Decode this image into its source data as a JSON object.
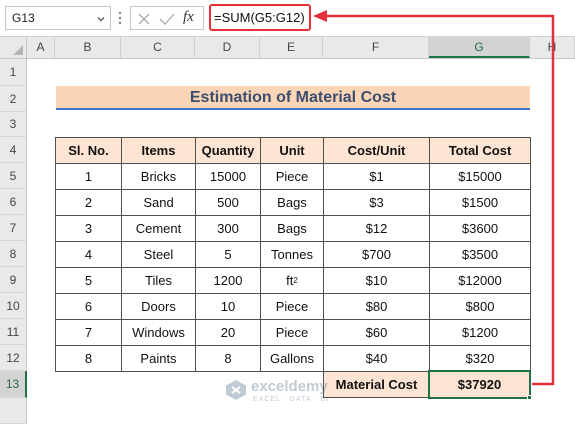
{
  "name_box": {
    "value": "G13"
  },
  "formula_bar": {
    "fx_label": "fx",
    "formula": "=SUM(G5:G12)"
  },
  "columns": [
    "A",
    "B",
    "C",
    "D",
    "E",
    "F",
    "G",
    "H"
  ],
  "selected_column": "G",
  "rows": [
    "1",
    "2",
    "3",
    "4",
    "5",
    "6",
    "7",
    "8",
    "9",
    "10",
    "11",
    "12",
    "13"
  ],
  "selected_row": "13",
  "title": "Estimation of Material Cost",
  "table": {
    "headers": [
      "Sl. No.",
      "Items",
      "Quantity",
      "Unit",
      "Cost/Unit",
      "Total Cost"
    ],
    "rows": [
      [
        "1",
        "Bricks",
        "15000",
        "Piece",
        "$1",
        "$15000"
      ],
      [
        "2",
        "Sand",
        "500",
        "Bags",
        "$3",
        "$1500"
      ],
      [
        "3",
        "Cement",
        "300",
        "Bags",
        "$12",
        "$3600"
      ],
      [
        "4",
        "Steel",
        "5",
        "Tonnes",
        "$700",
        "$3500"
      ],
      [
        "5",
        "Tiles",
        "1200",
        "ft",
        "$10",
        "$12000"
      ],
      [
        "6",
        "Doors",
        "10",
        "Piece",
        "$80",
        "$800"
      ],
      [
        "7",
        "Windows",
        "20",
        "Piece",
        "$60",
        "$1200"
      ],
      [
        "8",
        "Paints",
        "8",
        "Gallons",
        "$40",
        "$320"
      ]
    ],
    "unit_superscript": "2",
    "total_label": "Material Cost",
    "total_value": "$37920"
  },
  "watermark": {
    "name": "exceldemy",
    "tagline": "EXCEL · DATA · BI"
  },
  "colors": {
    "header_fill": "#fde4d3",
    "title_fill": "#fbd5b5",
    "title_underline": "#4472c4",
    "selection": "#217346",
    "annotation_arrow": "#e2313b"
  }
}
